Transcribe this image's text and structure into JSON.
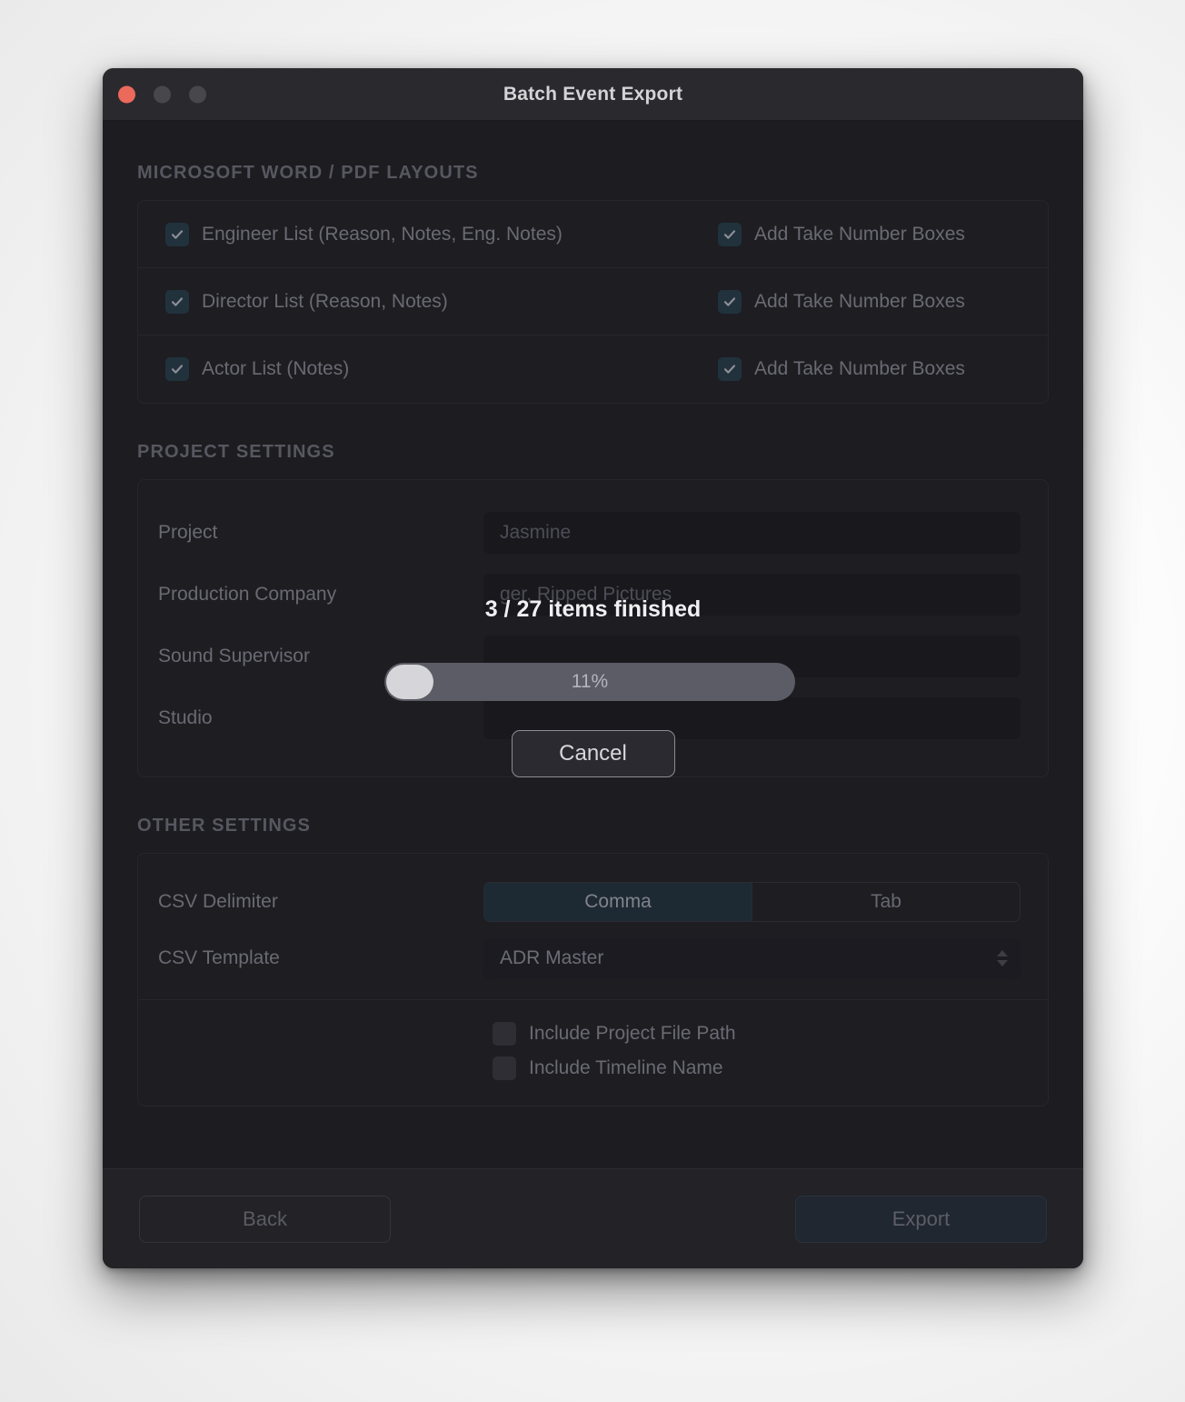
{
  "window": {
    "title": "Batch Event Export",
    "traffic_lights": [
      "close-button",
      "minimize-button",
      "maximize-button"
    ]
  },
  "sections": {
    "word_pdf": {
      "title": "MICROSOFT WORD / PDF LAYOUTS",
      "rows": [
        {
          "left_label": "Engineer List (Reason, Notes, Eng. Notes)",
          "left_checked": true,
          "right_label": "Add Take Number Boxes",
          "right_checked": true
        },
        {
          "left_label": "Director List (Reason, Notes)",
          "left_checked": true,
          "right_label": "Add Take Number Boxes",
          "right_checked": true
        },
        {
          "left_label": "Actor List (Notes)",
          "left_checked": true,
          "right_label": "Add Take Number Boxes",
          "right_checked": true
        }
      ]
    },
    "project_settings": {
      "title": "PROJECT SETTINGS",
      "fields": [
        {
          "label": "Project",
          "value": "Jasmine"
        },
        {
          "label": "Production Company",
          "value": "ger, Ripped Pictures"
        },
        {
          "label": "Sound Supervisor",
          "value": ""
        },
        {
          "label": "Studio",
          "value": ""
        }
      ]
    },
    "other_settings": {
      "title": "OTHER SETTINGS",
      "csv_delimiter": {
        "label": "CSV Delimiter",
        "options": [
          "Comma",
          "Tab"
        ],
        "selected": "Comma"
      },
      "csv_template": {
        "label": "CSV Template",
        "value": "ADR Master"
      },
      "toggles": [
        {
          "label": "Include Project File Path",
          "checked": false
        },
        {
          "label": "Include Timeline Name",
          "checked": false
        }
      ]
    }
  },
  "footer": {
    "back_label": "Back",
    "export_label": "Export"
  },
  "progress": {
    "status": "3 / 27 items finished",
    "percent_label": "11%",
    "percent_value": 11,
    "items_done": 3,
    "items_total": 27,
    "cancel_label": "Cancel"
  },
  "colors": {
    "window_bg": "#1c1c21",
    "titlebar_bg": "#2a2a2e",
    "close_red": "#eb6a5c",
    "checkbox_on": "#21323d",
    "accent_blue": "#1d2a33",
    "progress_track": "#5c5c66",
    "progress_fill": "#d6d6da"
  }
}
